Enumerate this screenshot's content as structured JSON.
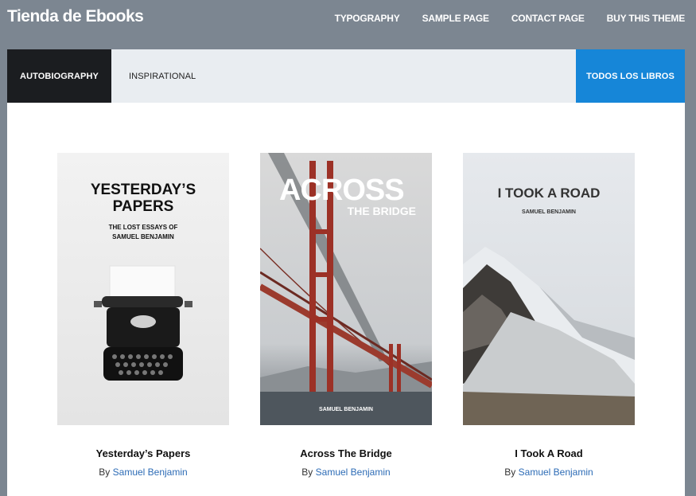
{
  "site": {
    "title": "Tienda de Ebooks"
  },
  "nav": [
    "TYPOGRAPHY",
    "SAMPLE PAGE",
    "CONTACT PAGE",
    "BUY THIS THEME"
  ],
  "tabs": {
    "active": "AUTOBIOGRAPHY",
    "inactive": "INSPIRATIONAL",
    "all": "TODOS LOS LIBROS"
  },
  "colors": {
    "page_bg": "#7c8691",
    "tab_active": "#1b1d20",
    "tab_all": "#1686d8",
    "link": "#2d6cb6"
  },
  "books": [
    {
      "title": "Yesterday’s Papers",
      "by": "By",
      "author": "Samuel Benjamin",
      "cover": {
        "title_line1": "YESTERDAY’S",
        "title_line2": "PAPERS",
        "subtitle_line1": "THE LOST ESSAYS OF",
        "subtitle_line2": "SAMUEL BENJAMIN",
        "image": "typewriter"
      }
    },
    {
      "title": "Across The Bridge",
      "by": "By",
      "author": "Samuel Benjamin",
      "cover": {
        "title": "ACROSS",
        "subtitle": "THE BRIDGE",
        "author": "SAMUEL BENJAMIN",
        "image": "golden-gate-bridge"
      }
    },
    {
      "title": "I Took A Road",
      "by": "By",
      "author": "Samuel Benjamin",
      "cover": {
        "title": "I TOOK A ROAD",
        "author": "SAMUEL BENJAMIN",
        "image": "snowy-mountain"
      }
    }
  ]
}
